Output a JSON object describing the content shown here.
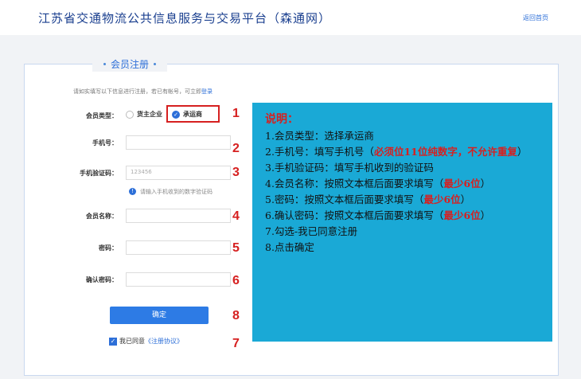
{
  "header": {
    "site_title": "江苏省交通物流公共信息服务与交易平台（森通网）",
    "home_link": "返回首页"
  },
  "form": {
    "legend": "会员注册",
    "hint_prefix": "请如实填写以下信息进行注册，若已有帐号，可立即",
    "hint_login": "登录",
    "member_type_label": "会员类型：",
    "option_shipper": "货主企业",
    "option_carrier": "承运商",
    "phone_label": "手机号：",
    "code_label": "手机验证码：",
    "code_value": "123456",
    "code_hint": "请输入手机收到的数字验证码",
    "name_label": "会员名称：",
    "password_label": "密码：",
    "confirm_password_label": "确认密码：",
    "confirm_button": "确定",
    "agree_text": "我已同意",
    "agree_link": "《注册协议》"
  },
  "steps": [
    "1",
    "2",
    "3",
    "4",
    "5",
    "6",
    "8",
    "7"
  ],
  "explain": {
    "title": "说明：",
    "l1": "1.会员类型：选择承运商",
    "l2a": "2.手机号：填写手机号（",
    "l2b": "必须位11位纯数字，不允许重复",
    "l2c": "）",
    "l3": "3.手机验证码：填写手机收到的验证码",
    "l4a": "4.会员名称：按照文本框后面要求填写（",
    "l4b": "最少6位",
    "l4c": "）",
    "l5a": "5.密码：按照文本框后面要求填写（",
    "l5b": "最少6位",
    "l5c": "）",
    "l6a": "6.确认密码：按照文本框后面要求填写（",
    "l6b": "最少6位",
    "l6c": "）",
    "l7": "7.勾选-我已同意注册",
    "l8": "8.点击确定"
  }
}
